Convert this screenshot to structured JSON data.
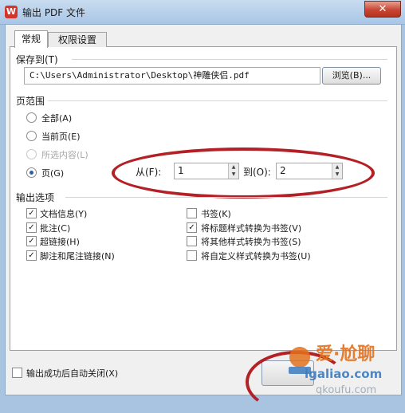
{
  "window": {
    "title": "输出 PDF 文件",
    "close_label": "✕",
    "app_icon_glyph": "W"
  },
  "tabs": [
    {
      "label": "常规",
      "active": true
    },
    {
      "label": "权限设置",
      "active": false
    }
  ],
  "save_to": {
    "label": "保存到(T)",
    "path": "C:\\Users\\Administrator\\Desktop\\神雕侠侣.pdf",
    "browse_label": "浏览(B)..."
  },
  "page_range": {
    "label": "页范围",
    "options": [
      {
        "label": "全部(A)",
        "selected": false,
        "enabled": true
      },
      {
        "label": "当前页(E)",
        "selected": false,
        "enabled": true
      },
      {
        "label": "所选内容(L)",
        "selected": false,
        "enabled": false
      },
      {
        "label": "页(G)",
        "selected": true,
        "enabled": true
      }
    ],
    "from_label": "从(F):",
    "from_value": "1",
    "to_label": "到(O):",
    "to_value": "2"
  },
  "output_options": {
    "label": "输出选项",
    "left": [
      {
        "label": "文档信息(Y)",
        "checked": true
      },
      {
        "label": "批注(C)",
        "checked": true
      },
      {
        "label": "超链接(H)",
        "checked": true
      },
      {
        "label": "脚注和尾注链接(N)",
        "checked": true
      }
    ],
    "right": [
      {
        "label": "书签(K)",
        "checked": false
      },
      {
        "label": "将标题样式转换为书签(V)",
        "checked": true
      },
      {
        "label": "将其他样式转换为书签(S)",
        "checked": false
      },
      {
        "label": "将自定义样式转换为书签(U)",
        "checked": false
      }
    ]
  },
  "footer": {
    "auto_close_label": "输出成功后自动关闭(X)",
    "auto_close_checked": false
  },
  "watermark": {
    "text_top": "爱·尬聊",
    "text_mid": "igaliao.com",
    "text_bot": "qkoufu.com"
  },
  "colors": {
    "annotation_red": "#b32025",
    "titlebar": "#a9c6e6",
    "close_button": "#c74632"
  }
}
